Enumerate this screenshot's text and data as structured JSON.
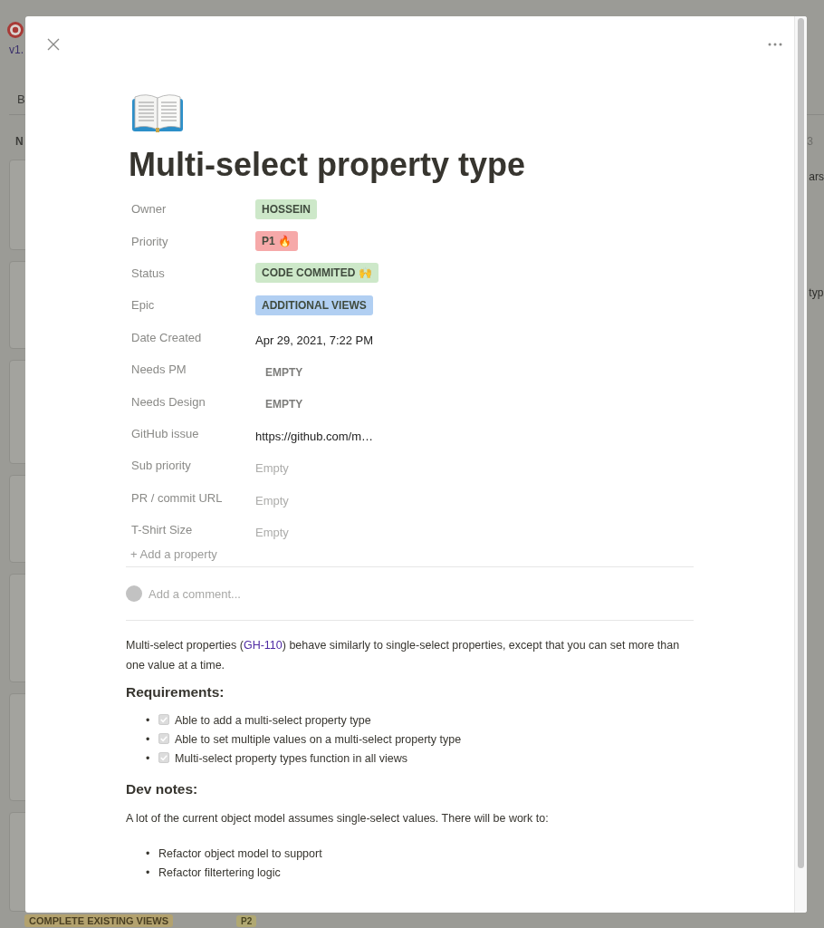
{
  "board": {
    "version": "v1.",
    "view_tab": "B",
    "group_label": "N",
    "column_count": "3",
    "card_snippets": [
      "ars",
      "typ"
    ],
    "bottom_tag": "COMPLETE EXISTING VIEWS",
    "bottom_badge": "P2"
  },
  "card": {
    "title": "Multi-select property type",
    "properties": [
      {
        "name": "Owner",
        "kind": "tag",
        "value": "HOSSEIN",
        "color": "#cde8c9"
      },
      {
        "name": "Priority",
        "kind": "tag",
        "value": "P1 🔥",
        "color": "#f6a9a9"
      },
      {
        "name": "Status",
        "kind": "tag",
        "value": "CODE COMMITED 🙌",
        "color": "#cde8c9"
      },
      {
        "name": "Epic",
        "kind": "tag",
        "value": "ADDITIONAL VIEWS",
        "color": "#b1cff2"
      },
      {
        "name": "Date Created",
        "kind": "text",
        "value": "Apr 29, 2021, 7:22 PM"
      },
      {
        "name": "Needs PM",
        "kind": "empty",
        "value": "EMPTY"
      },
      {
        "name": "Needs Design",
        "kind": "empty",
        "value": "EMPTY"
      },
      {
        "name": "GitHub issue",
        "kind": "text",
        "value": "https://github.com/m…"
      },
      {
        "name": "Sub priority",
        "kind": "placeholder",
        "value": "Empty"
      },
      {
        "name": "PR / commit URL",
        "kind": "placeholder",
        "value": "Empty"
      },
      {
        "name": "T-Shirt Size",
        "kind": "placeholder",
        "value": "Empty"
      }
    ],
    "add_property": "+ Add a property",
    "comment": {
      "placeholder": "Add a comment..."
    },
    "description": [
      {
        "kind": "paragraph",
        "before": "Multi-select properties (",
        "link": "GH-110",
        "after": ") behave similarly to single-select properties, except that you can set more than one value at a time."
      },
      {
        "kind": "heading",
        "text": "Requirements:"
      },
      {
        "kind": "checklist",
        "marker": "•",
        "items": [
          {
            "text": "Able to add a multi-select property type",
            "checked": true
          },
          {
            "text": "Able to set multiple values on a multi-select property type",
            "checked": true
          },
          {
            "text": "Multi-select property types function in all views",
            "checked": true
          }
        ]
      },
      {
        "kind": "heading",
        "text": "Dev notes:"
      },
      {
        "kind": "paragraph",
        "text": "A lot of the current object model assumes single-select values. There will be work to:"
      },
      {
        "kind": "bullets",
        "marker": "•",
        "items": [
          "Refactor object model to support",
          "Refactor filtertering logic"
        ]
      }
    ]
  }
}
